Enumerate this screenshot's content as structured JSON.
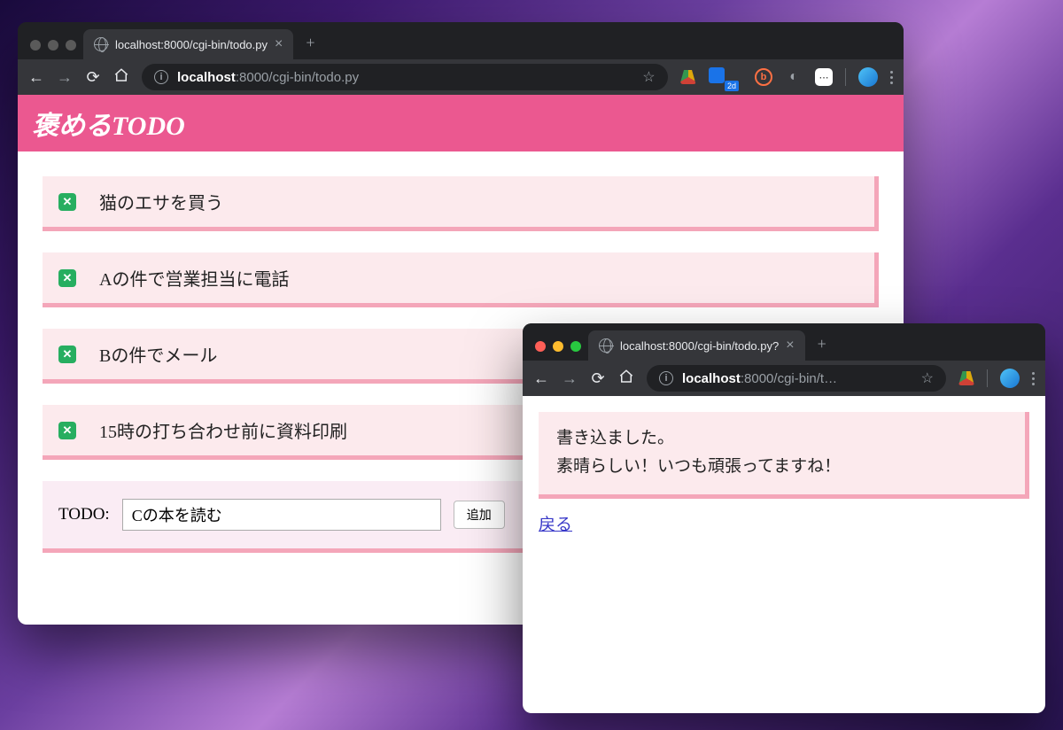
{
  "window1": {
    "tab_title": "localhost:8000/cgi-bin/todo.py",
    "url_prefix": "localhost",
    "url_rest": ":8000/cgi-bin/todo.py",
    "app_title": "褒めるTODO",
    "todos": [
      "猫のエサを買う",
      "Aの件で営業担当に電話",
      "Bの件でメール",
      "15時の打ち合わせ前に資料印刷"
    ],
    "form_label": "TODO:",
    "form_value": "Cの本を読む",
    "submit_label": "追加"
  },
  "window2": {
    "tab_title": "localhost:8000/cgi-bin/todo.py?",
    "url_prefix": "localhost",
    "url_rest": ":8000/cgi-bin/t…",
    "msg_line1": "書き込ました。",
    "msg_line2": "素晴らしい！いつも頑張ってますね！",
    "back_label": "戻る"
  },
  "ext_badge": "2d"
}
